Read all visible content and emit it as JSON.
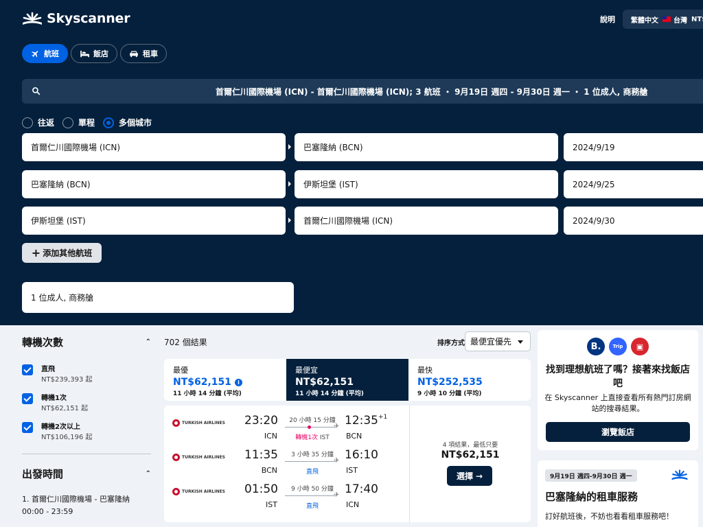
{
  "brand": {
    "name": "Skyscanner",
    "logo_icon": "sunburst-logo-icon"
  },
  "header": {
    "help": "說明",
    "locale": {
      "language": "繁體中文",
      "country": "台灣",
      "currency": "NT$"
    }
  },
  "product_tabs": [
    {
      "label": "航班",
      "icon": "plane-icon",
      "active": true
    },
    {
      "label": "飯店",
      "icon": "bed-icon",
      "active": false
    },
    {
      "label": "租車",
      "icon": "car-icon",
      "active": false
    }
  ],
  "search_summary": "首爾仁川國際機場 (ICN) - 首爾仁川國際機場 (ICN); 3 航班 ・ 9月19日 週四 - 9月30日 週一 ・ 1 位成人, 商務艙",
  "trip_types": [
    {
      "label": "往返",
      "selected": false
    },
    {
      "label": "單程",
      "selected": false
    },
    {
      "label": "多個城市",
      "selected": true
    }
  ],
  "legs": [
    {
      "from": "首爾仁川國際機場 (ICN)",
      "to": "巴塞隆納 (BCN)",
      "date": "2024/9/19"
    },
    {
      "from": "巴塞隆納 (BCN)",
      "to": "伊斯坦堡 (IST)",
      "date": "2024/9/25"
    },
    {
      "from": "伊斯坦堡 (IST)",
      "to": "首爾仁川國際機場 (ICN)",
      "date": "2024/9/30"
    }
  ],
  "add_flight": "添加其他航班",
  "passengers": "1 位成人, 商務艙",
  "filters": {
    "stops_title": "轉機次數",
    "stops": [
      {
        "label": "直飛",
        "price": "NT$239,393 起",
        "checked": true
      },
      {
        "label": "轉機1次",
        "price": "NT$62,151 起",
        "checked": true
      },
      {
        "label": "轉機2次以上",
        "price": "NT$106,196 起",
        "checked": true
      }
    ],
    "departure_title": "出發時間",
    "departure_leg": "1. 首爾仁川國際機場 - 巴塞隆納",
    "departure_range": "00:00 - 23:59"
  },
  "results": {
    "count": "702 個結果",
    "sort_label": "排序方式",
    "sort_value": "最便宜優先"
  },
  "sort_tabs": [
    {
      "title": "最優",
      "price": "NT$62,151",
      "duration": "11 小時 14 分鐘 (平均)",
      "active": false,
      "info": true
    },
    {
      "title": "最便宜",
      "price": "NT$62,151",
      "duration": "11 小時 14 分鐘 (平均)",
      "active": true,
      "info": false
    },
    {
      "title": "最快",
      "price": "NT$252,535",
      "duration": "9 小時 10 分鐘 (平均)",
      "active": false,
      "info": false
    }
  ],
  "itinerary": {
    "airline": "TURKISH AIRLINES",
    "legs": [
      {
        "dep_time": "23:20",
        "dep_code": "ICN",
        "duration": "20 小時 15 分鐘",
        "stops": "轉機1次",
        "via": "IST",
        "direct": false,
        "arr_time": "12:35",
        "arr_offset": "+1",
        "arr_code": "BCN"
      },
      {
        "dep_time": "11:35",
        "dep_code": "BCN",
        "duration": "3 小時 35 分鐘",
        "stops": "直飛",
        "via": "",
        "direct": true,
        "arr_time": "16:10",
        "arr_offset": "",
        "arr_code": "IST"
      },
      {
        "dep_time": "01:50",
        "dep_code": "IST",
        "duration": "9 小時 50 分鐘",
        "stops": "直飛",
        "via": "",
        "direct": true,
        "arr_time": "17:40",
        "arr_offset": "",
        "arr_code": "ICN"
      }
    ],
    "deals": "4 項結果，最低只要",
    "price": "NT$62,151",
    "select": "選擇"
  },
  "hotel_ad": {
    "brands": [
      "B.",
      "Trip",
      "agoda"
    ],
    "title": "找到理想航班了嗎？接著來找飯店吧",
    "text": "在 Skyscanner 上直接查看所有熱門訂房網站的搜尋結果。",
    "button": "瀏覽飯店"
  },
  "car_ad": {
    "dates": "9月19日 週四-9月30日 週一",
    "title": "巴塞隆納的租車服務",
    "text": "訂好航班後，不妨也看看租車服務吧！"
  },
  "colors": {
    "navy": "#05203c",
    "blue": "#0062e3",
    "background": "#eff3f8",
    "stop_pink": "#e70866"
  }
}
